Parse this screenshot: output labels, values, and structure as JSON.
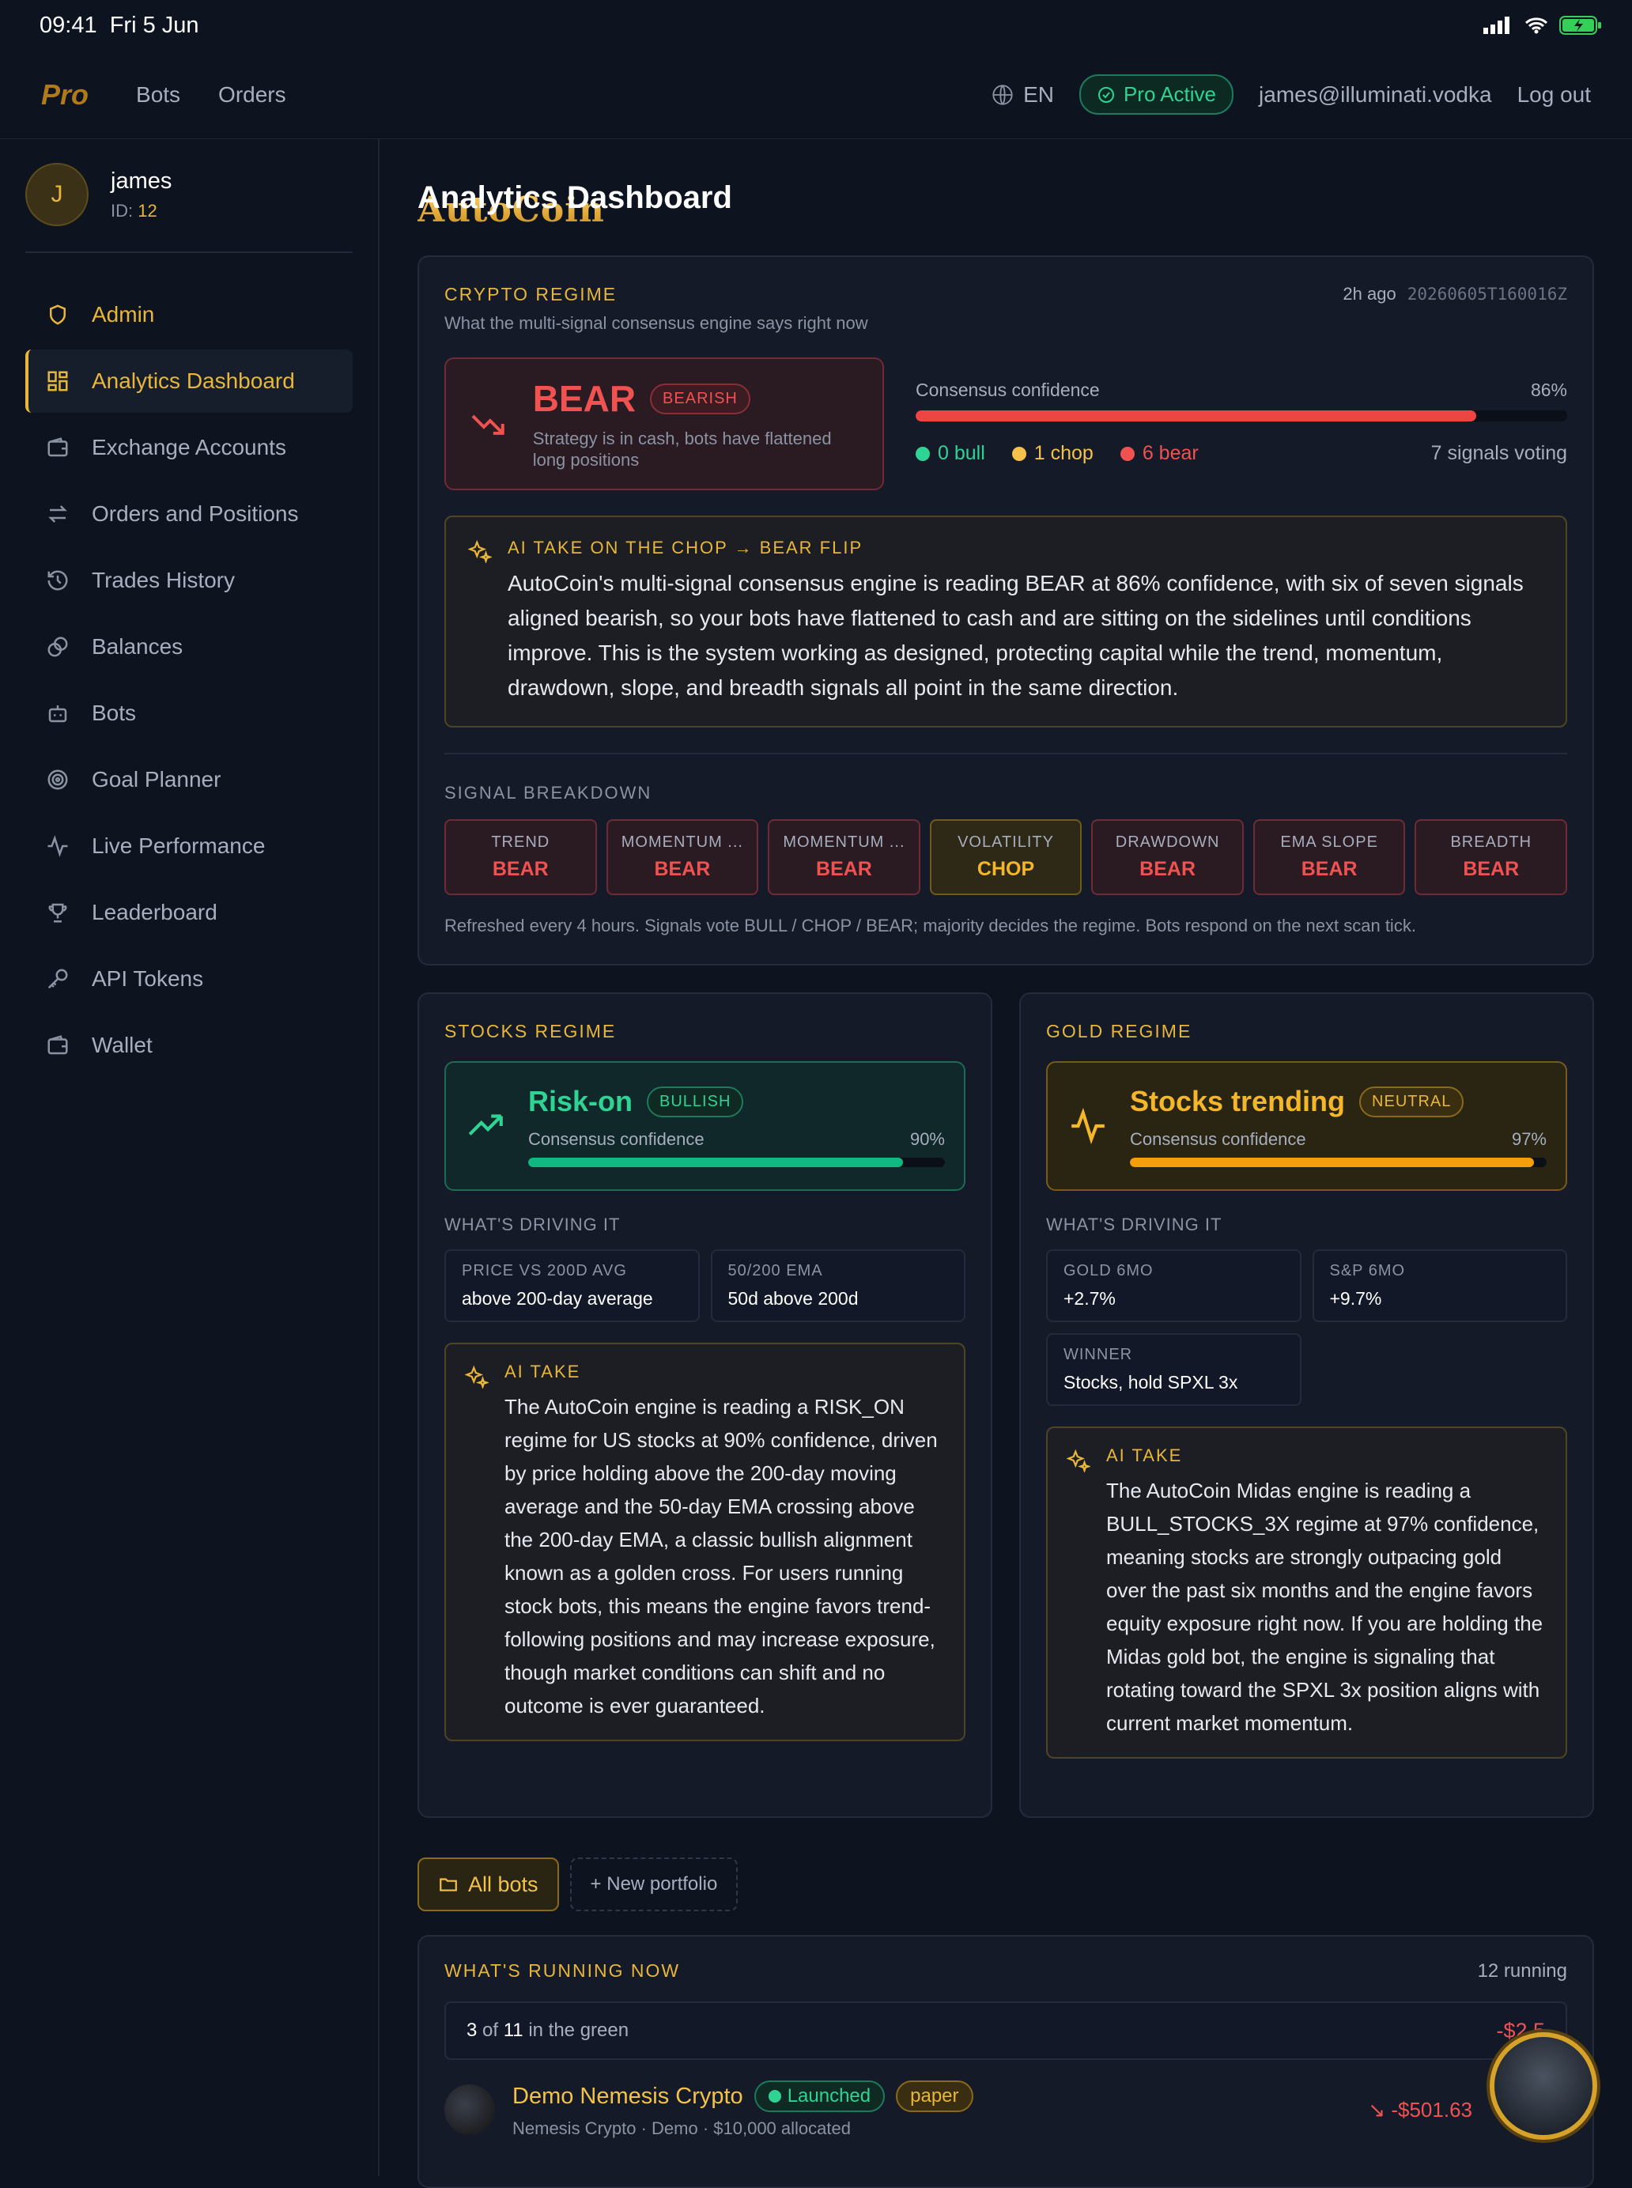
{
  "status": {
    "time": "09:41",
    "date": "Fri 5 Jun"
  },
  "nav": {
    "logo_main": "AutoCoin",
    "logo_pro": "Pro",
    "links": [
      "Bots",
      "Orders"
    ],
    "lang": "EN",
    "pro_badge": "Pro Active",
    "email": "james@illuminati.vodka",
    "logout": "Log out"
  },
  "profile": {
    "initial": "J",
    "name": "james",
    "id_label": "ID:",
    "id": "12"
  },
  "sidebar": [
    {
      "label": "Admin",
      "icon": "shield-icon"
    },
    {
      "label": "Analytics Dashboard",
      "icon": "grid-icon"
    },
    {
      "label": "Exchange Accounts",
      "icon": "wallet-icon"
    },
    {
      "label": "Orders and Positions",
      "icon": "swap-icon"
    },
    {
      "label": "Trades History",
      "icon": "history-icon"
    },
    {
      "label": "Balances",
      "icon": "coins-icon"
    },
    {
      "label": "Bots",
      "icon": "bot-icon"
    },
    {
      "label": "Goal Planner",
      "icon": "target-icon"
    },
    {
      "label": "Live Performance",
      "icon": "pulse-icon"
    },
    {
      "label": "Leaderboard",
      "icon": "trophy-icon"
    },
    {
      "label": "API Tokens",
      "icon": "key-icon"
    },
    {
      "label": "Wallet",
      "icon": "wallet-icon"
    }
  ],
  "page_title": "Analytics Dashboard",
  "crypto": {
    "title": "CRYPTO REGIME",
    "subtitle": "What the multi-signal consensus engine says right now",
    "ago": "2h ago",
    "stamp": "20260605T160016Z",
    "regime": "BEAR",
    "badge": "BEARISH",
    "desc": "Strategy is in cash, bots have flattened long positions",
    "conf_label": "Consensus confidence",
    "conf_value": "86%",
    "conf_fraction": 0.86,
    "bull": "0 bull",
    "chop": "1 chop",
    "bear": "6 bear",
    "voting": "7 signals voting",
    "ai_label": "AI TAKE ON THE CHOP → BEAR FLIP",
    "ai_text": "AutoCoin's multi-signal consensus engine is reading BEAR at 86% confidence, with six of seven signals aligned bearish, so your bots have flattened to cash and are sitting on the sidelines until conditions improve. This is the system working as designed, protecting capital while the trend, momentum, drawdown, slope, and breadth signals all point in the same direction.",
    "breakdown_label": "SIGNAL BREAKDOWN",
    "signals": [
      {
        "name": "TREND",
        "value": "BEAR"
      },
      {
        "name": "MOMENTUM ...",
        "value": "BEAR"
      },
      {
        "name": "MOMENTUM ...",
        "value": "BEAR"
      },
      {
        "name": "VOLATILITY",
        "value": "CHOP"
      },
      {
        "name": "DRAWDOWN",
        "value": "BEAR"
      },
      {
        "name": "EMA SLOPE",
        "value": "BEAR"
      },
      {
        "name": "BREADTH",
        "value": "BEAR"
      }
    ],
    "footnote": "Refreshed every 4 hours. Signals vote BULL / CHOP / BEAR; majority decides the regime. Bots respond on the next scan tick."
  },
  "stocks": {
    "title": "STOCKS REGIME",
    "regime": "Risk-on",
    "badge": "BULLISH",
    "conf_label": "Consensus confidence",
    "conf_value": "90%",
    "conf_fraction": 0.9,
    "driving": "WHAT'S DRIVING IT",
    "k1": "PRICE VS 200D AVG",
    "v1": "above 200-day average",
    "k2": "50/200 EMA",
    "v2": "50d above 200d",
    "ai_label": "AI TAKE",
    "ai_text": "The AutoCoin engine is reading a RISK_ON regime for US stocks at 90% confidence, driven by price holding above the 200-day moving average and the 50-day EMA crossing above the 200-day EMA, a classic bullish alignment known as a golden cross. For users running stock bots, this means the engine favors trend-following positions and may increase exposure, though market conditions can shift and no outcome is ever guaranteed."
  },
  "gold": {
    "title": "GOLD REGIME",
    "regime": "Stocks trending",
    "badge": "NEUTRAL",
    "conf_label": "Consensus confidence",
    "conf_value": "97%",
    "conf_fraction": 0.97,
    "driving": "WHAT'S DRIVING IT",
    "k1": "GOLD 6MO",
    "v1": "+2.7%",
    "k2": "S&P 6MO",
    "v2": "+9.7%",
    "k3": "WINNER",
    "v3": "Stocks, hold SPXL 3x",
    "ai_label": "AI TAKE",
    "ai_text": "The AutoCoin Midas engine is reading a BULL_STOCKS_3X regime at 97% confidence, meaning stocks are strongly outpacing gold over the past six months and the engine favors equity exposure right now. If you are holding the Midas gold bot, the engine is signaling that rotating toward the SPXL 3x position aligns with current market momentum."
  },
  "portfolio": {
    "all": "All bots",
    "new": "+ New portfolio"
  },
  "running": {
    "title": "WHAT'S RUNNING NOW",
    "count": "12 running",
    "green_n": "3",
    "green_of": "of",
    "green_total": "11",
    "green_suffix": "in the green",
    "total_pnl": "-$2.5",
    "bot_name": "Demo Nemesis Crypto",
    "bot_status": "Launched",
    "bot_mode": "paper",
    "bot_meta": "Nemesis Crypto · Demo · $10,000 allocated",
    "bot_pnl": "-$501.63"
  }
}
